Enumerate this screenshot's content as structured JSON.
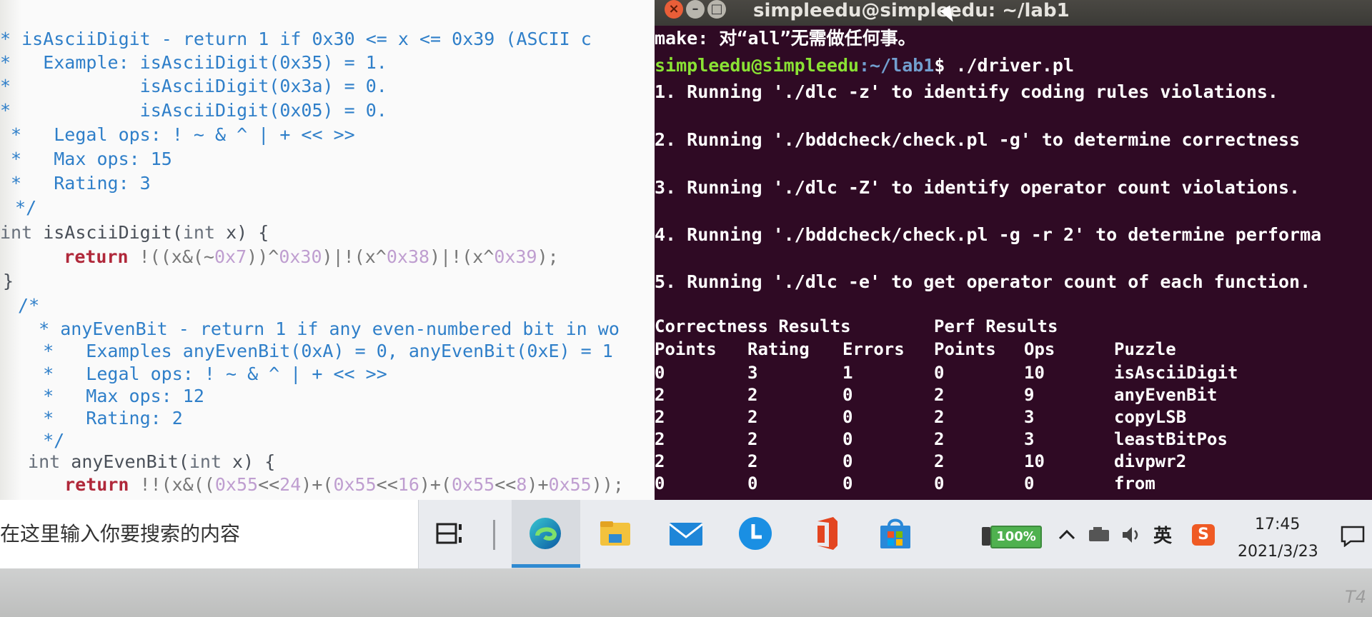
{
  "editor": {
    "lines": [
      [
        [
          "cm",
          "* isAsciiDigit - return 1 if 0x30 <= x <= 0x39 (ASCII c"
        ]
      ],
      [
        [
          "cm",
          "*   Example: isAsciiDigit(0x35) = 1."
        ]
      ],
      [
        [
          "cm",
          "*            isAsciiDigit(0x3a) = 0."
        ]
      ],
      [
        [
          "cm",
          "*            isAsciiDigit(0x05) = 0."
        ]
      ],
      [
        [
          "cm",
          " *   Legal ops: ! ~ & ^ | + << >>"
        ]
      ],
      [
        [
          "cm",
          " *   Max ops: 15"
        ]
      ],
      [
        [
          "cm",
          " *   Rating: 3"
        ]
      ],
      [
        [
          "cm",
          " */"
        ]
      ],
      [
        [
          "ty",
          "int"
        ],
        [
          "fn",
          " isAsciiDigit("
        ],
        [
          "ty",
          "int"
        ],
        [
          "fn",
          " x) {"
        ]
      ],
      [
        [
          "fn",
          "     "
        ],
        [
          "kw",
          "return"
        ],
        [
          "op",
          " !((x&(~"
        ],
        [
          "nm",
          "0x7"
        ],
        [
          "op",
          "))^"
        ],
        [
          "nm",
          "0x30"
        ],
        [
          "op",
          ")|!(x^"
        ],
        [
          "nm",
          "0x38"
        ],
        [
          "op",
          ")|!(x^"
        ],
        [
          "nm",
          "0x39"
        ],
        [
          "op",
          ");"
        ]
      ],
      [
        [
          "fn",
          "}"
        ]
      ],
      [
        [
          "cm",
          " /*"
        ]
      ],
      [
        [
          "cm",
          "  * anyEvenBit - return 1 if any even-numbered bit in wo"
        ]
      ],
      [
        [
          "cm",
          "  *   Examples anyEvenBit(0xA) = 0, anyEvenBit(0xE) = 1"
        ]
      ],
      [
        [
          "cm",
          "  *   Legal ops: ! ~ & ^ | + << >>"
        ]
      ],
      [
        [
          "cm",
          "  *   Max ops: 12"
        ]
      ],
      [
        [
          "cm",
          "  *   Rating: 2"
        ]
      ],
      [
        [
          "cm",
          "  */"
        ]
      ],
      [
        [
          "ty",
          " int"
        ],
        [
          "fn",
          " anyEvenBit("
        ],
        [
          "ty",
          "int"
        ],
        [
          "fn",
          " x) {"
        ]
      ],
      [
        [
          "fn",
          "  "
        ],
        [
          "kw",
          "return"
        ],
        [
          "op",
          " !!(x&(("
        ],
        [
          "nm",
          "0x55"
        ],
        [
          "op",
          "<<"
        ],
        [
          "nm",
          "24"
        ],
        [
          "op",
          ")+("
        ],
        [
          "nm",
          "0x55"
        ],
        [
          "op",
          "<<"
        ],
        [
          "nm",
          "16"
        ],
        [
          "op",
          ")+("
        ],
        [
          "nm",
          "0x55"
        ],
        [
          "op",
          "<<"
        ],
        [
          "nm",
          "8"
        ],
        [
          "op",
          ")+"
        ],
        [
          "nm",
          "0x55"
        ],
        [
          "op",
          "));"
        ]
      ]
    ]
  },
  "terminal": {
    "window_title": "simpleedu@simpleedu: ~/lab1",
    "buttons": {
      "close": "×",
      "minimize": "–",
      "maximize": "□"
    },
    "make_line": "make: 对“all”无需做任何事。",
    "prompt": {
      "user_host": "simpleedu@simpleedu",
      "path": ":~/lab1",
      "symbol": "$ ",
      "command": "./driver.pl"
    },
    "steps": [
      "1. Running './dlc -z' to identify coding rules violations.",
      "2. Running './bddcheck/check.pl -g' to determine correctness",
      "3. Running './dlc -Z' to identify operator count violations.",
      "4. Running './bddcheck/check.pl -g -r 2' to determine performa",
      "5. Running './dlc -e' to get operator count of each function."
    ],
    "results": {
      "group_headers": [
        "Correctness Results",
        "Perf Results"
      ],
      "columns": [
        "Points",
        "Rating",
        "Errors",
        "Points",
        "Ops",
        "Puzzle"
      ],
      "rows": [
        [
          "0",
          "3",
          "1",
          "0",
          "10",
          "isAsciiDigit"
        ],
        [
          "2",
          "2",
          "0",
          "2",
          "9",
          "anyEvenBit"
        ],
        [
          "2",
          "2",
          "0",
          "2",
          "3",
          "copyLSB"
        ],
        [
          "2",
          "2",
          "0",
          "2",
          "3",
          "leastBitPos"
        ],
        [
          "2",
          "2",
          "0",
          "2",
          "10",
          "divpwr2"
        ],
        [
          "0",
          "0",
          "0",
          "0",
          "0",
          "from"
        ]
      ]
    }
  },
  "taskbar": {
    "search_placeholder": "在这里输入你要搜索的内容",
    "apps": [
      "task-view-icon",
      "edge-icon",
      "file-explorer-icon",
      "mail-icon",
      "clock-app-icon",
      "office-icon",
      "store-icon"
    ],
    "tray": {
      "battery": "100%",
      "language": "英",
      "input_method": "S",
      "time": "17:45",
      "date": "2021/3/23"
    }
  },
  "bezel_text": "T4"
}
